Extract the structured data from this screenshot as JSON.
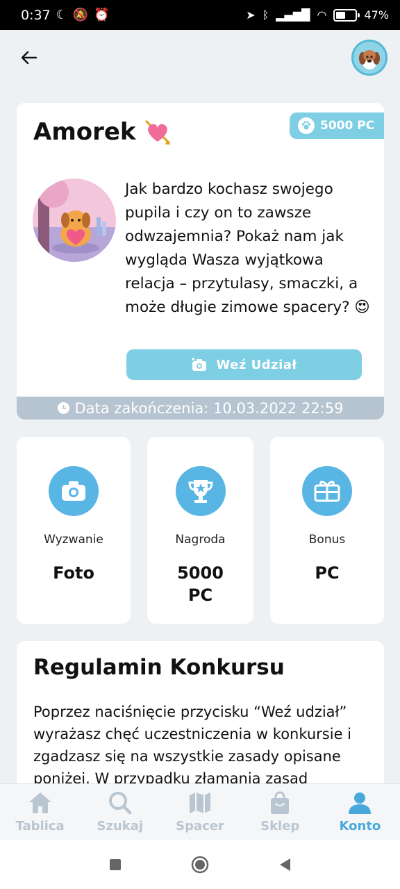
{
  "status_bar": {
    "time": "0:37",
    "battery_percent": "47%",
    "battery_level": 0.47
  },
  "contest": {
    "title": "Amorek",
    "points_badge": "5000 PC",
    "description": "Jak bardzo kochasz swojego pupila i czy on to zawsze odwzajemnia? Pokaż nam jak wygląda Wasza wyjątkowa relacja – przytulasy, smaczki, a może długie zimowe spacery? 😍",
    "join_label": "Weź Udział",
    "deadline": "Data zakończenia: 10.03.2022 22:59"
  },
  "stats": [
    {
      "label": "Wyzwanie",
      "value": "Foto"
    },
    {
      "label": "Nagroda",
      "value": "5000 PC"
    },
    {
      "label": "Bonus",
      "value": "PC"
    }
  ],
  "rules": {
    "title": "Regulamin Konkursu",
    "text": "Poprzez naciśnięcie przycisku “Weź udział” wyrażasz chęć uczestniczenia w konkursie i zgadzasz się na wszystkie zasady opisane poniżej. W przypadku złamania zasad"
  },
  "nav": [
    {
      "label": "Tablica",
      "icon": "home-icon",
      "active": false
    },
    {
      "label": "Szukaj",
      "icon": "search-icon",
      "active": false
    },
    {
      "label": "Spacer",
      "icon": "map-icon",
      "active": false
    },
    {
      "label": "Sklep",
      "icon": "shopping-bag-icon",
      "active": false
    },
    {
      "label": "Konto",
      "icon": "user-icon",
      "active": true
    }
  ],
  "colors": {
    "accent": "#7ecfe3",
    "icon_blue": "#58b5e4",
    "nav_active": "#4aa9dc",
    "nav_inactive": "#b9c5d1",
    "deadline_bar": "#b6c3d0"
  }
}
